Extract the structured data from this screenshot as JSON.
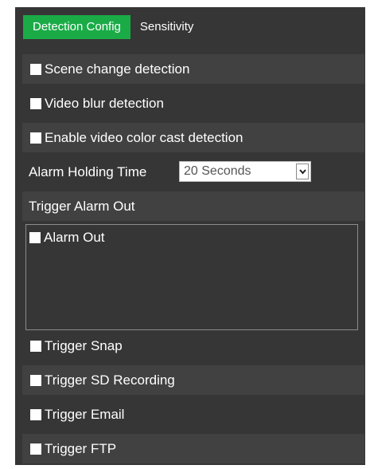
{
  "tabs": [
    {
      "label": "Detection Config"
    },
    {
      "label": "Sensitivity"
    }
  ],
  "options": {
    "scene_change": "Scene change detection",
    "video_blur": "Video blur detection",
    "color_cast": "Enable video color cast detection"
  },
  "alarm_holding": {
    "label": "Alarm Holding Time",
    "value": "20 Seconds"
  },
  "trigger_alarm_out": {
    "label": "Trigger Alarm Out",
    "items": [
      "Alarm Out"
    ]
  },
  "triggers": {
    "snap": "Trigger Snap",
    "sd_recording": "Trigger SD Recording",
    "email": "Trigger Email",
    "ftp": "Trigger FTP"
  },
  "colors": {
    "panel_bg": "#363636",
    "row_alt": "#414141",
    "active_tab": "#1aab47"
  }
}
